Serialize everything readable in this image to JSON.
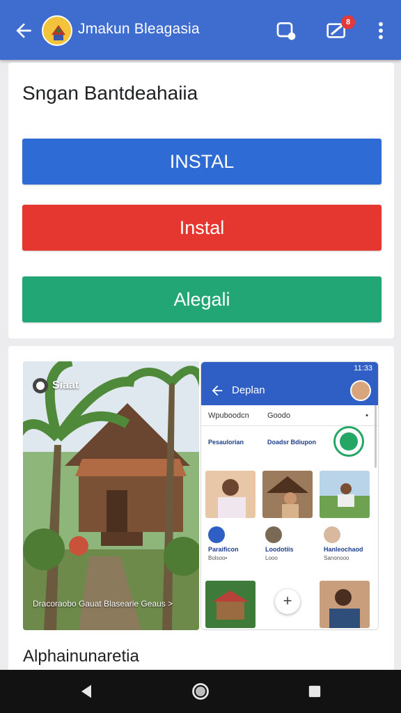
{
  "appbar": {
    "title": "Jmakun Bleagasia",
    "badge_count": "8",
    "icons": [
      "arrow-back-icon",
      "app-logo",
      "chat-bubble-icon",
      "edit-message-icon",
      "more-vert-icon"
    ]
  },
  "actions_card": {
    "heading": "Sngan Bantdeahaiia",
    "buttons": [
      {
        "label": "INSTAL",
        "color": "#2f6bd5"
      },
      {
        "label": "Instal",
        "color": "#e5362f"
      },
      {
        "label": "Alegali",
        "color": "#23a675"
      }
    ]
  },
  "preview_card": {
    "photo": {
      "tag": "Siaat",
      "caption": "Dracoraobo Gauat Blasearie Geaus >"
    },
    "phone": {
      "status_time": "11:33",
      "title": "Deplan",
      "tabs": [
        "Wpuboodcn",
        "Goodo",
        "•"
      ],
      "items": [
        {
          "name": "Pesaulorian",
          "sub": ""
        },
        {
          "name": "Doadsr Bdiupon",
          "sub": ""
        },
        {
          "name": "Paraificon",
          "sub": "Bolsoo•"
        },
        {
          "name": "Loodotiis",
          "sub": "Looo"
        },
        {
          "name": "Hanleochaod",
          "sub": "Sanonooo"
        }
      ],
      "fab_label": "+"
    },
    "bottom_text": "Alphainunaretia"
  },
  "navbar": {
    "icons": [
      "back-triangle-icon",
      "home-circle-icon",
      "recents-square-icon"
    ]
  }
}
